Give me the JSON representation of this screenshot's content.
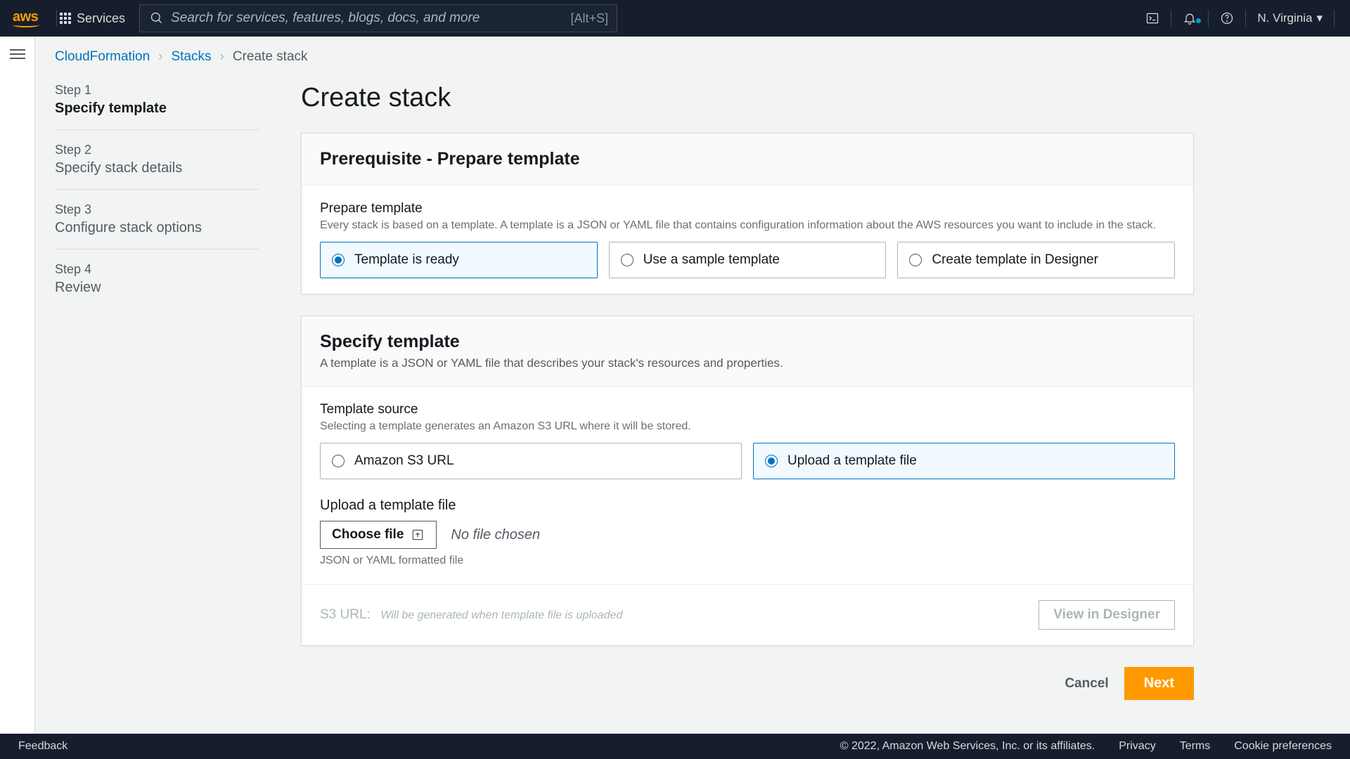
{
  "nav": {
    "logo_text": "aws",
    "services": "Services",
    "search_placeholder": "Search for services, features, blogs, docs, and more",
    "search_hotkey": "[Alt+S]",
    "region": "N. Virginia"
  },
  "breadcrumbs": {
    "root": "CloudFormation",
    "stacks": "Stacks",
    "current": "Create stack"
  },
  "wizard": [
    {
      "num": "Step 1",
      "title": "Specify template",
      "active": true
    },
    {
      "num": "Step 2",
      "title": "Specify stack details",
      "active": false
    },
    {
      "num": "Step 3",
      "title": "Configure stack options",
      "active": false
    },
    {
      "num": "Step 4",
      "title": "Review",
      "active": false
    }
  ],
  "page_title": "Create stack",
  "card1": {
    "header": "Prerequisite - Prepare template",
    "label": "Prepare template",
    "help": "Every stack is based on a template. A template is a JSON or YAML file that contains configuration information about the AWS resources you want to include in the stack.",
    "opt1": "Template is ready",
    "opt2": "Use a sample template",
    "opt3": "Create template in Designer"
  },
  "card2": {
    "header": "Specify template",
    "header_sub": "A template is a JSON or YAML file that describes your stack's resources and properties.",
    "src_label": "Template source",
    "src_help": "Selecting a template generates an Amazon S3 URL where it will be stored.",
    "src_opt1": "Amazon S3 URL",
    "src_opt2": "Upload a template file",
    "upload_label": "Upload a template file",
    "choose_file": "Choose file",
    "no_file": "No file chosen",
    "upload_help": "JSON or YAML formatted file",
    "s3_label": "S3 URL:",
    "s3_val": "Will be generated when template file is uploaded",
    "designer_btn": "View in Designer"
  },
  "actions": {
    "cancel": "Cancel",
    "next": "Next"
  },
  "footer": {
    "feedback": "Feedback",
    "copyright": "© 2022, Amazon Web Services, Inc. or its affiliates.",
    "privacy": "Privacy",
    "terms": "Terms",
    "cookies": "Cookie preferences"
  }
}
